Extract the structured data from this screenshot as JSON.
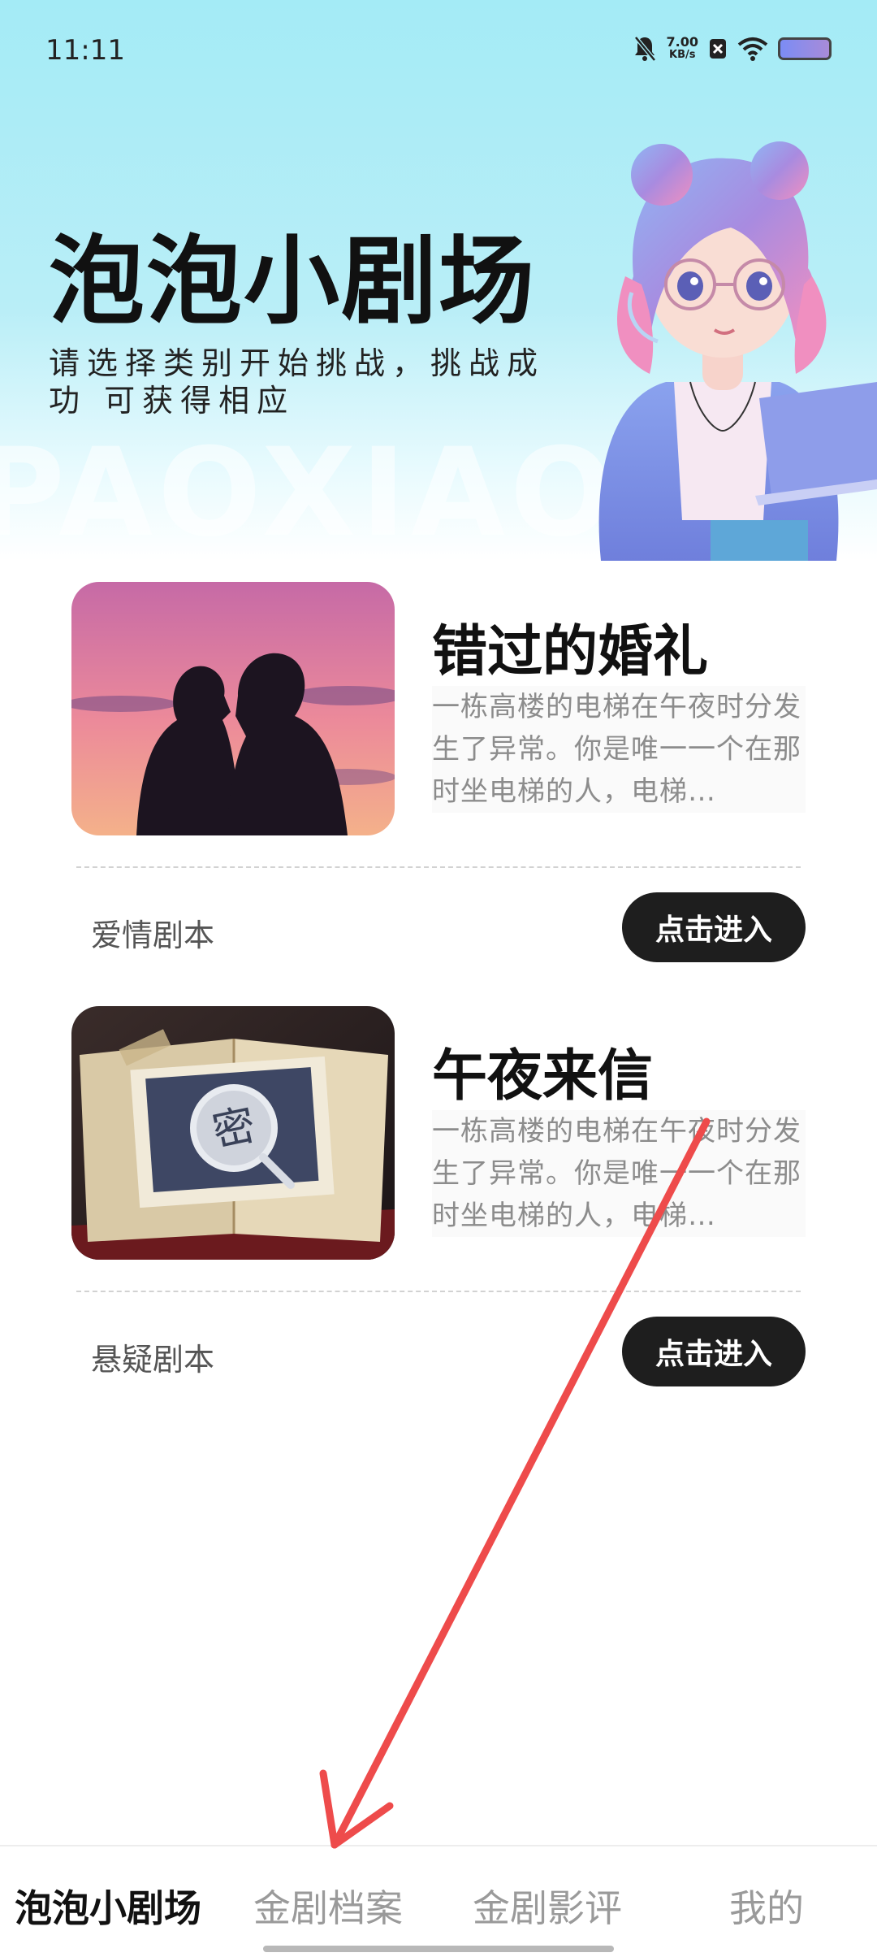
{
  "status_bar": {
    "time": "11:11",
    "net_speed_value": "7.00",
    "net_speed_unit": "KB/s"
  },
  "hero": {
    "title": "泡泡小剧场",
    "subtitle": "请选择类别开始挑战，挑战成功 可获得相应",
    "watermark": "PAOXIAO"
  },
  "cards": [
    {
      "title": "错过的婚礼",
      "description": "一栋高楼的电梯在午夜时分发生了异常。你是唯一一个在那时坐电梯的人，电梯…",
      "category": "爱情剧本",
      "button": "点击进入"
    },
    {
      "title": "午夜来信",
      "description": "一栋高楼的电梯在午夜时分发生了异常。你是唯一一个在那时坐电梯的人，电梯…",
      "category": "悬疑剧本",
      "button": "点击进入",
      "thumb_stamp": "密"
    }
  ],
  "tabbar": {
    "tabs": [
      {
        "label": "泡泡小剧场",
        "active": true
      },
      {
        "label": "金剧档案",
        "active": false
      },
      {
        "label": "金剧影评",
        "active": false
      },
      {
        "label": "我的",
        "active": false
      }
    ]
  },
  "colors": {
    "hero_top": "#a4ebf6",
    "button_bg": "#1e1e1e",
    "annotation_arrow": "#ee4b4b"
  }
}
